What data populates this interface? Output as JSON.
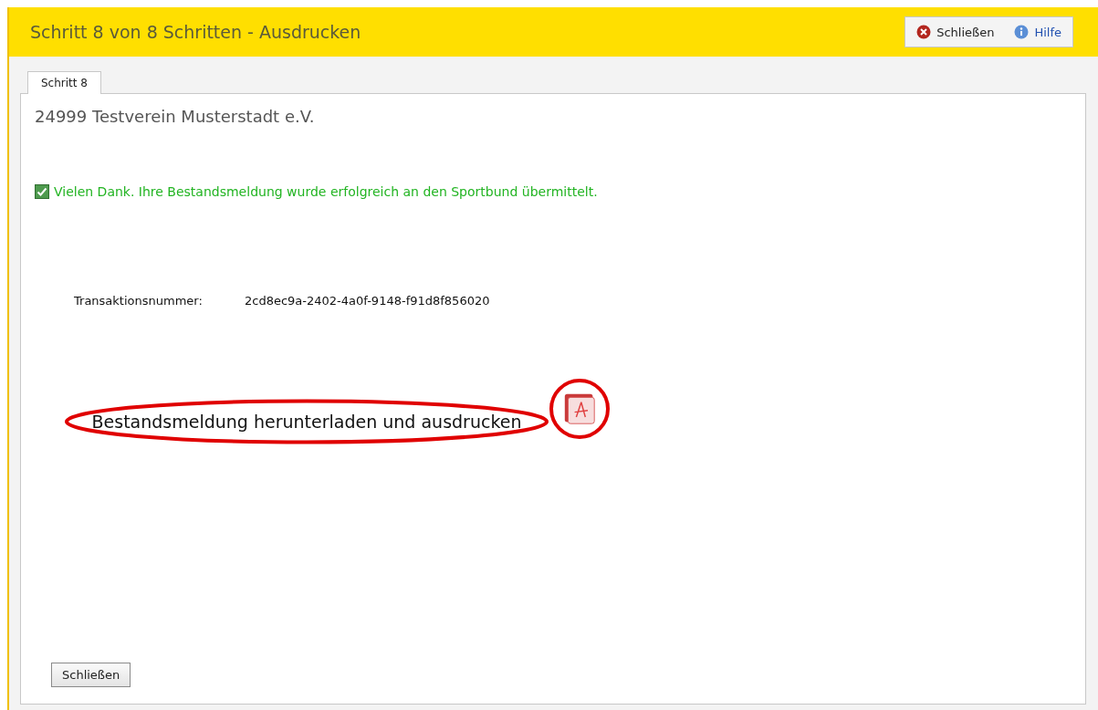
{
  "header": {
    "title": "Schritt 8 von 8 Schritten - Ausdrucken",
    "actions": [
      {
        "kind": "close",
        "label": "Schließen"
      },
      {
        "kind": "help",
        "label": "Hilfe"
      }
    ]
  },
  "tabs": [
    {
      "label": "Schritt 8",
      "selected": true
    }
  ],
  "club": "24999 Testverein Musterstadt e.V.",
  "message": {
    "checked": true,
    "text": "Vielen Dank. Ihre Bestandsmeldung wurde erfolgreich an den Sportbund übermittelt."
  },
  "transaction": {
    "label": "Transaktionsnummer:",
    "value": "2cd8ec9a-2402-4a0f-9148-f91d8f856020"
  },
  "download": {
    "label": "Bestandsmeldung herunterladen und ausdrucken"
  },
  "buttons": [
    "Schließen"
  ]
}
